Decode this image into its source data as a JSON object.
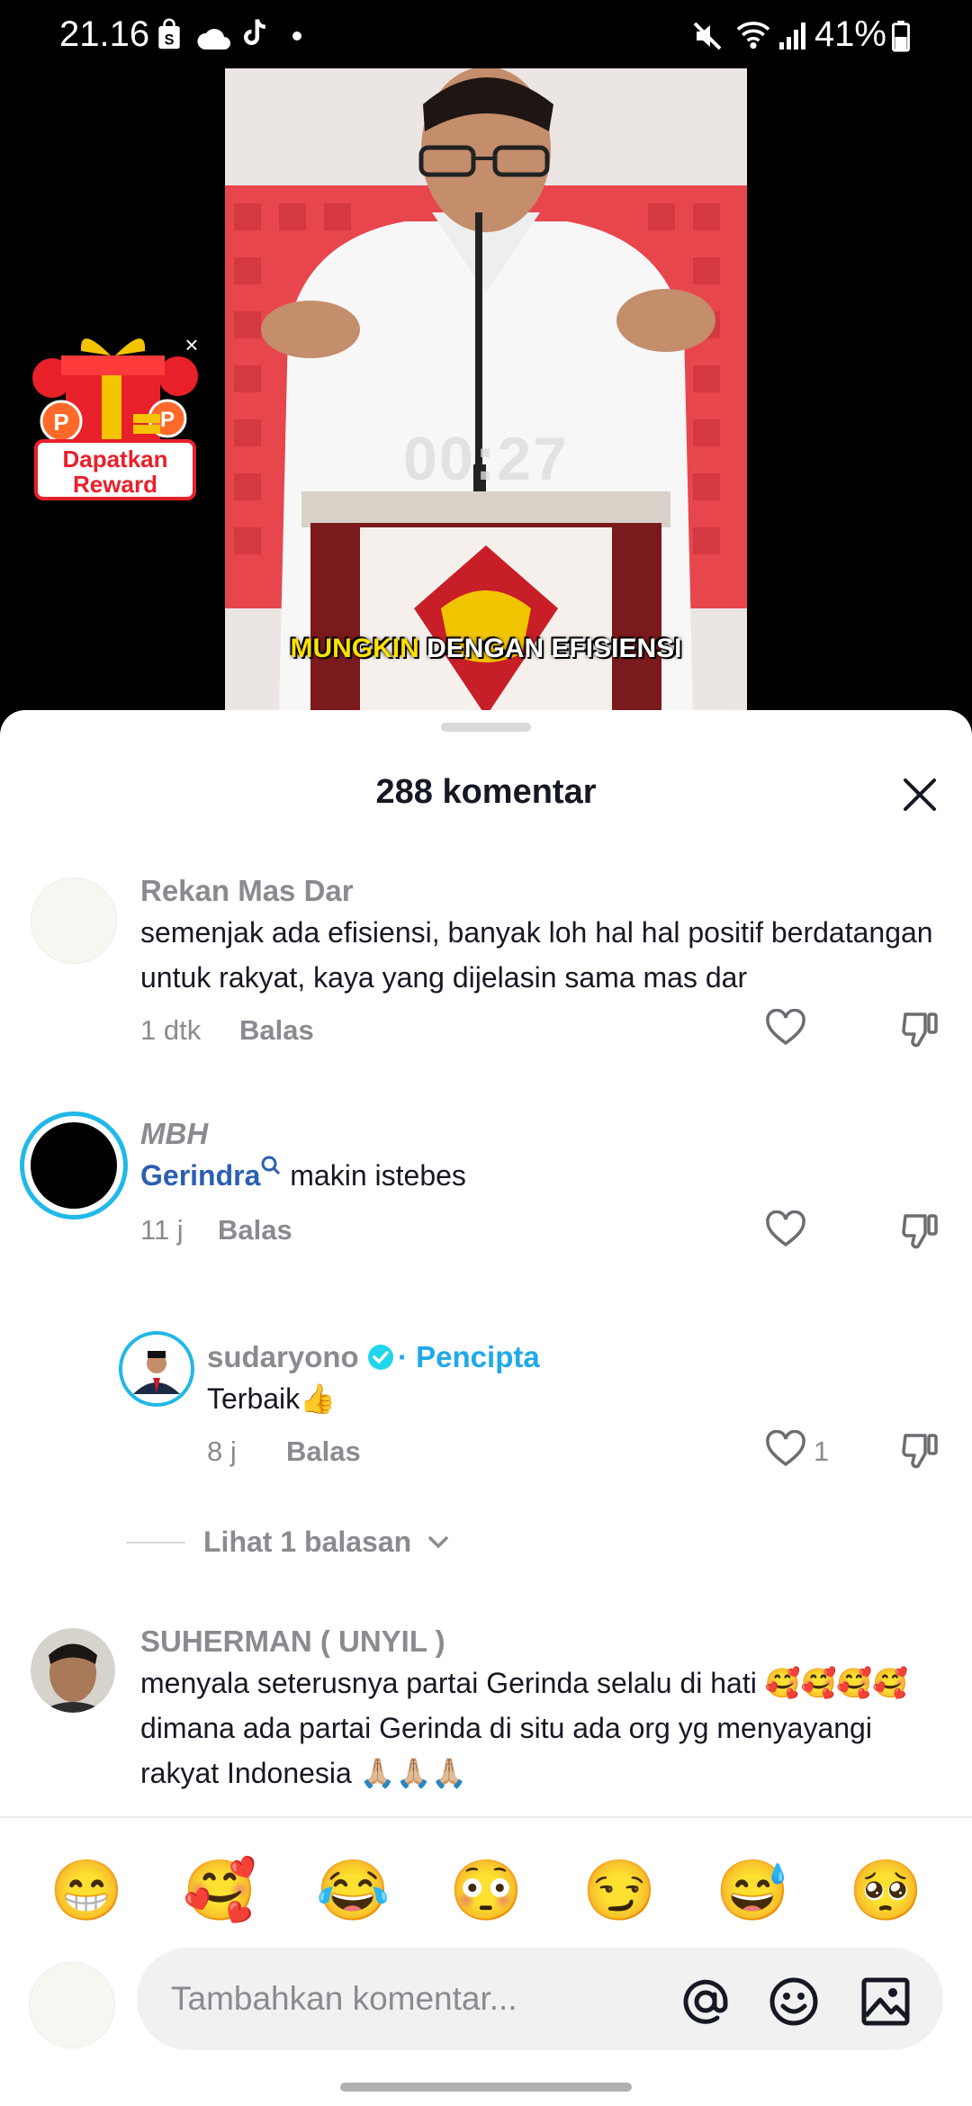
{
  "status_bar": {
    "time": "21.16",
    "battery": "41%",
    "icons": [
      "shopee-bag-icon",
      "cloud-icon",
      "tiktok-icon",
      "dot-icon",
      "mute-icon",
      "wifi-icon",
      "signal-icon",
      "battery-icon"
    ]
  },
  "video": {
    "timer": "00:27",
    "subtitle_highlight": "MUNGKIN",
    "subtitle_rest": " DENGAN EFISIENSI"
  },
  "reward": {
    "label_line1": "Dapatkan",
    "label_line2": "Reward",
    "close": "×"
  },
  "sheet": {
    "title": "288 komentar"
  },
  "comments": [
    {
      "username": "Rekan Mas Dar",
      "text_line1": "semenjak ada efisiensi, banyak loh hal hal positif berdatangan",
      "text_line2": "untuk rakyat, kaya yang dijelasin sama mas dar",
      "time": "1 dtk",
      "reply": "Balas"
    },
    {
      "username": "MBH",
      "tag": "Gerindra",
      "text": " makin istebes",
      "time": "11 j",
      "reply": "Balas"
    },
    {
      "username": "sudaryono",
      "creator_label": "· Pencipta",
      "text": "Terbaik👍",
      "time": "8 j",
      "reply": "Balas",
      "likes": "1"
    },
    {
      "username": "SUHERMAN ( UNYIL )",
      "text_line1": "menyala seterusnya partai Gerinda selalu di hati 🥰🥰🥰🥰",
      "text_line2": "dimana ada partai Gerinda di situ ada org yg menyayangi",
      "text_line3": "rakyat Indonesia 🙏🏼🙏🏼🙏🏼"
    }
  ],
  "view_replies": "Lihat 1 balasan",
  "emojis": [
    "😁",
    "🥰",
    "😂",
    "😳",
    "😏",
    "😅",
    "🥺"
  ],
  "input": {
    "placeholder": "Tambahkan komentar...",
    "icons": [
      "at-icon",
      "emoji-icon",
      "image-icon"
    ]
  },
  "colors": {
    "accent_blue": "#2b5fb3",
    "creator_blue": "#20a9e8",
    "verified": "#20d5ec",
    "text_gray": "#8a8b91",
    "red": "#e8202a"
  }
}
